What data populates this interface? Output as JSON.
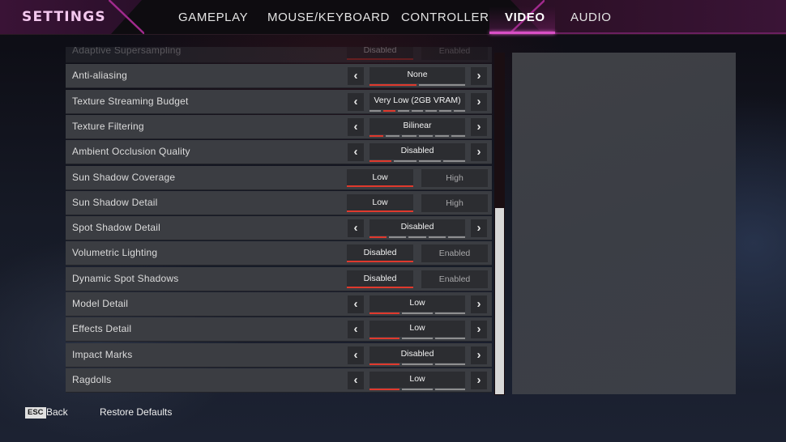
{
  "header": {
    "title": "SETTINGS",
    "tabs": [
      {
        "label": "GAMEPLAY",
        "active": false
      },
      {
        "label": "MOUSE/KEYBOARD",
        "active": false
      },
      {
        "label": "CONTROLLER",
        "active": false
      },
      {
        "label": "VIDEO",
        "active": true
      },
      {
        "label": "AUDIO",
        "active": false
      }
    ]
  },
  "colors": {
    "accent_pink": "#d94fc6",
    "selection_red": "#e0392d",
    "row_bg": "#3b3d42"
  },
  "settings": [
    {
      "label": "Adaptive Supersampling",
      "type": "toggle",
      "options": [
        "Disabled",
        "Enabled"
      ],
      "selected": 0,
      "partially_hidden": true
    },
    {
      "label": "Anti-aliasing",
      "type": "cycle",
      "value": "None",
      "option_count": 2,
      "selected_index": 0
    },
    {
      "label": "Texture Streaming Budget",
      "type": "cycle",
      "value": "Very Low (2GB VRAM)",
      "option_count": 7,
      "selected_index": 1
    },
    {
      "label": "Texture Filtering",
      "type": "cycle",
      "value": "Bilinear",
      "option_count": 6,
      "selected_index": 0
    },
    {
      "label": "Ambient Occlusion Quality",
      "type": "cycle",
      "value": "Disabled",
      "option_count": 4,
      "selected_index": 0
    },
    {
      "label": "Sun Shadow Coverage",
      "type": "toggle",
      "options": [
        "Low",
        "High"
      ],
      "selected": 0
    },
    {
      "label": "Sun Shadow Detail",
      "type": "toggle",
      "options": [
        "Low",
        "High"
      ],
      "selected": 0
    },
    {
      "label": "Spot Shadow Detail",
      "type": "cycle",
      "value": "Disabled",
      "option_count": 5,
      "selected_index": 0
    },
    {
      "label": "Volumetric Lighting",
      "type": "toggle",
      "options": [
        "Disabled",
        "Enabled"
      ],
      "selected": 0
    },
    {
      "label": "Dynamic Spot Shadows",
      "type": "toggle",
      "options": [
        "Disabled",
        "Enabled"
      ],
      "selected": 0
    },
    {
      "label": "Model Detail",
      "type": "cycle",
      "value": "Low",
      "option_count": 3,
      "selected_index": 0
    },
    {
      "label": "Effects Detail",
      "type": "cycle",
      "value": "Low",
      "option_count": 3,
      "selected_index": 0
    },
    {
      "label": "Impact Marks",
      "type": "cycle",
      "value": "Disabled",
      "option_count": 3,
      "selected_index": 0
    },
    {
      "label": "Ragdolls",
      "type": "cycle",
      "value": "Low",
      "option_count": 3,
      "selected_index": 0
    }
  ],
  "arrows": {
    "left": "‹",
    "right": "›"
  },
  "scroll": {
    "position_fraction": 0.45,
    "visible_fraction": 0.55
  },
  "footer": {
    "esc_key": "ESC",
    "back_label": "Back",
    "restore_label": "Restore Defaults"
  }
}
